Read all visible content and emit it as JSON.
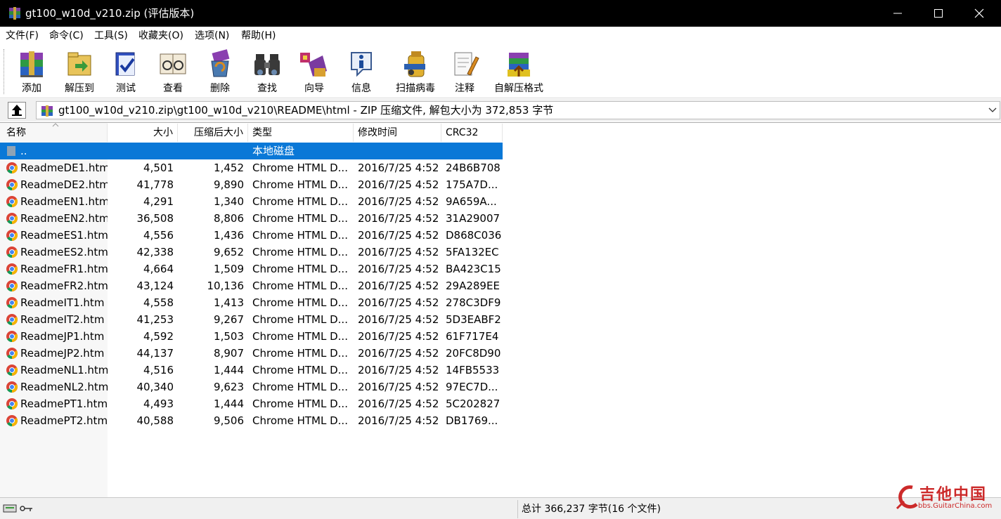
{
  "window": {
    "title": "gt100_w10d_v210.zip (评估版本)"
  },
  "menu": [
    "文件(F)",
    "命令(C)",
    "工具(S)",
    "收藏夹(O)",
    "选项(N)",
    "帮助(H)"
  ],
  "toolbar": [
    {
      "label": "添加",
      "icon": "add-archive-icon"
    },
    {
      "label": "解压到",
      "icon": "extract-to-icon"
    },
    {
      "label": "测试",
      "icon": "test-icon"
    },
    {
      "label": "查看",
      "icon": "view-icon"
    },
    {
      "label": "删除",
      "icon": "delete-icon"
    },
    {
      "label": "查找",
      "icon": "find-icon"
    },
    {
      "label": "向导",
      "icon": "wizard-icon"
    },
    {
      "label": "信息",
      "icon": "info-icon"
    },
    {
      "label": "扫描病毒",
      "icon": "scan-virus-icon"
    },
    {
      "label": "注释",
      "icon": "comment-icon"
    },
    {
      "label": "自解压格式",
      "icon": "sfx-icon"
    }
  ],
  "address": {
    "path": "gt100_w10d_v210.zip\\gt100_w10d_v210\\README\\html - ZIP 压缩文件, 解包大小为 372,853 字节"
  },
  "columns": {
    "name": "名称",
    "size": "大小",
    "packed": "压缩后大小",
    "type": "类型",
    "modified": "修改时间",
    "crc": "CRC32"
  },
  "parent_row": {
    "name": "..",
    "type": "本地磁盘"
  },
  "files": [
    {
      "name": "ReadmeDE1.htm",
      "size": "4,501",
      "packed": "1,452",
      "type": "Chrome HTML D...",
      "modified": "2016/7/25 4:52",
      "crc": "24B6B708"
    },
    {
      "name": "ReadmeDE2.htm",
      "size": "41,778",
      "packed": "9,890",
      "type": "Chrome HTML D...",
      "modified": "2016/7/25 4:52",
      "crc": "175A7D..."
    },
    {
      "name": "ReadmeEN1.htm",
      "size": "4,291",
      "packed": "1,340",
      "type": "Chrome HTML D...",
      "modified": "2016/7/25 4:52",
      "crc": "9A659A..."
    },
    {
      "name": "ReadmeEN2.htm",
      "size": "36,508",
      "packed": "8,806",
      "type": "Chrome HTML D...",
      "modified": "2016/7/25 4:52",
      "crc": "31A29007"
    },
    {
      "name": "ReadmeES1.htm",
      "size": "4,556",
      "packed": "1,436",
      "type": "Chrome HTML D...",
      "modified": "2016/7/25 4:52",
      "crc": "D868C036"
    },
    {
      "name": "ReadmeES2.htm",
      "size": "42,338",
      "packed": "9,652",
      "type": "Chrome HTML D...",
      "modified": "2016/7/25 4:52",
      "crc": "5FA132EC"
    },
    {
      "name": "ReadmeFR1.htm",
      "size": "4,664",
      "packed": "1,509",
      "type": "Chrome HTML D...",
      "modified": "2016/7/25 4:52",
      "crc": "BA423C15"
    },
    {
      "name": "ReadmeFR2.htm",
      "size": "43,124",
      "packed": "10,136",
      "type": "Chrome HTML D...",
      "modified": "2016/7/25 4:52",
      "crc": "29A289EE"
    },
    {
      "name": "ReadmeIT1.htm",
      "size": "4,558",
      "packed": "1,413",
      "type": "Chrome HTML D...",
      "modified": "2016/7/25 4:52",
      "crc": "278C3DF9"
    },
    {
      "name": "ReadmeIT2.htm",
      "size": "41,253",
      "packed": "9,267",
      "type": "Chrome HTML D...",
      "modified": "2016/7/25 4:52",
      "crc": "5D3EABF2"
    },
    {
      "name": "ReadmeJP1.htm",
      "size": "4,592",
      "packed": "1,503",
      "type": "Chrome HTML D...",
      "modified": "2016/7/25 4:52",
      "crc": "61F717E4"
    },
    {
      "name": "ReadmeJP2.htm",
      "size": "44,137",
      "packed": "8,907",
      "type": "Chrome HTML D...",
      "modified": "2016/7/25 4:52",
      "crc": "20FC8D90"
    },
    {
      "name": "ReadmeNL1.htm",
      "size": "4,516",
      "packed": "1,444",
      "type": "Chrome HTML D...",
      "modified": "2016/7/25 4:52",
      "crc": "14FB5533"
    },
    {
      "name": "ReadmeNL2.htm",
      "size": "40,340",
      "packed": "9,623",
      "type": "Chrome HTML D...",
      "modified": "2016/7/25 4:52",
      "crc": "97EC7D..."
    },
    {
      "name": "ReadmePT1.htm",
      "size": "4,493",
      "packed": "1,444",
      "type": "Chrome HTML D...",
      "modified": "2016/7/25 4:52",
      "crc": "5C202827"
    },
    {
      "name": "ReadmePT2.htm",
      "size": "40,588",
      "packed": "9,506",
      "type": "Chrome HTML D...",
      "modified": "2016/7/25 4:52",
      "crc": "DB1769..."
    }
  ],
  "status": {
    "summary": "总计 366,237 字节(16 个文件)"
  },
  "watermark": {
    "text": "吉他中国",
    "url": "bbs.GuitarChina.com"
  },
  "colors": {
    "titlebar": "#000000",
    "selection": "#0a78d7",
    "watermark": "#cc2a2a"
  }
}
